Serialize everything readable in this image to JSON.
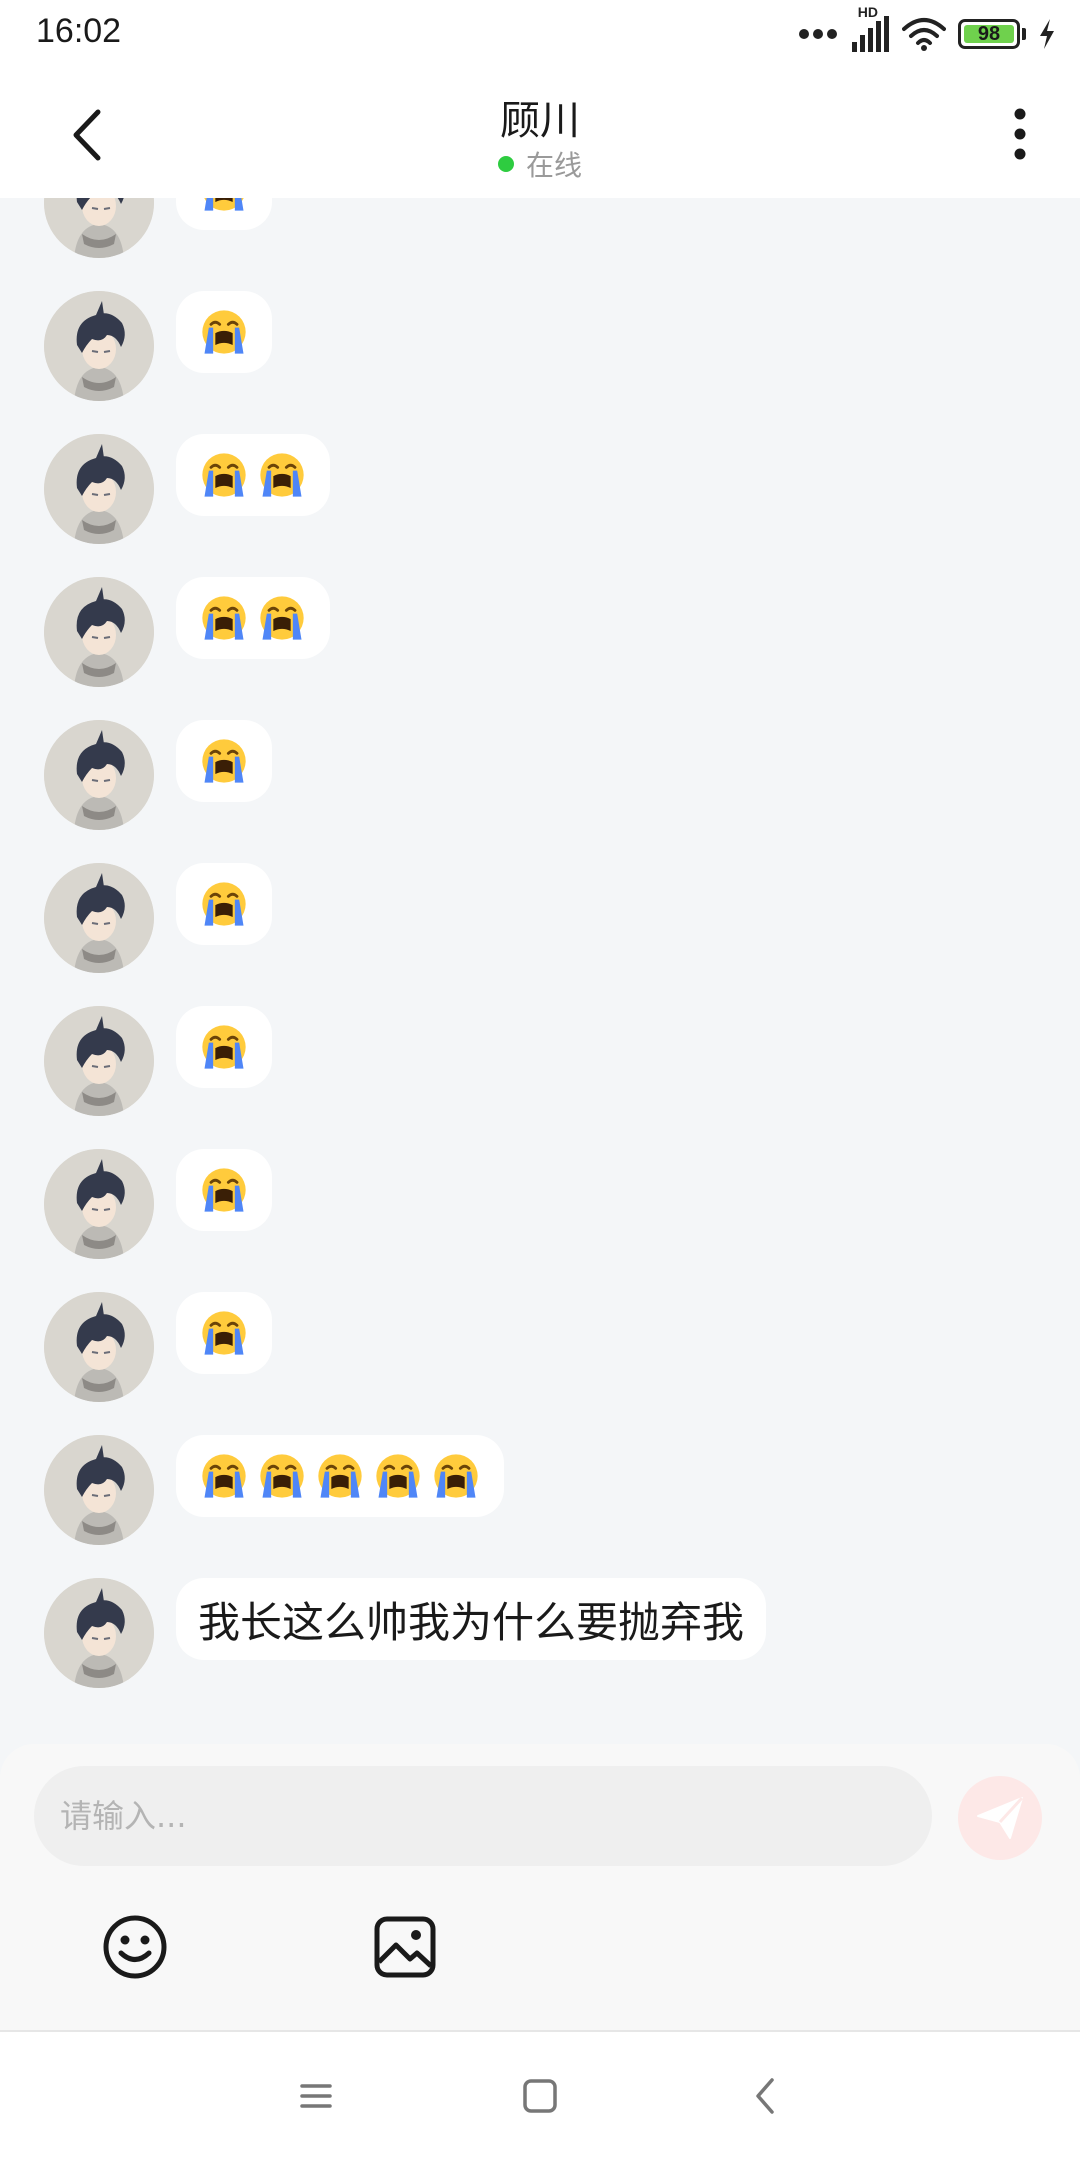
{
  "status_bar": {
    "time": "16:02",
    "network": "HD",
    "battery": "98"
  },
  "header": {
    "contact_name": "顾川",
    "status": "在线"
  },
  "messages": [
    {
      "count": 1
    },
    {
      "count": 1
    },
    {
      "count": 2
    },
    {
      "count": 2
    },
    {
      "count": 1
    },
    {
      "count": 1
    },
    {
      "count": 1
    },
    {
      "count": 1
    },
    {
      "count": 1
    },
    {
      "count": 5
    },
    {
      "text": "我长这么帅我为什么要抛弃我"
    }
  ],
  "composer": {
    "placeholder": "请输入..."
  },
  "colors": {
    "accent_send": "#f08c84",
    "online": "#2ecc40",
    "bubble": "#ffffff",
    "background": "#f4f6f8"
  },
  "icons": {
    "back": "chevron-left-icon",
    "more": "more-vertical-icon",
    "send": "paper-plane-icon",
    "emoji": "smiley-icon",
    "image": "image-icon",
    "nav": [
      "menu-icon",
      "home-square-icon",
      "back-chevron-icon"
    ]
  }
}
